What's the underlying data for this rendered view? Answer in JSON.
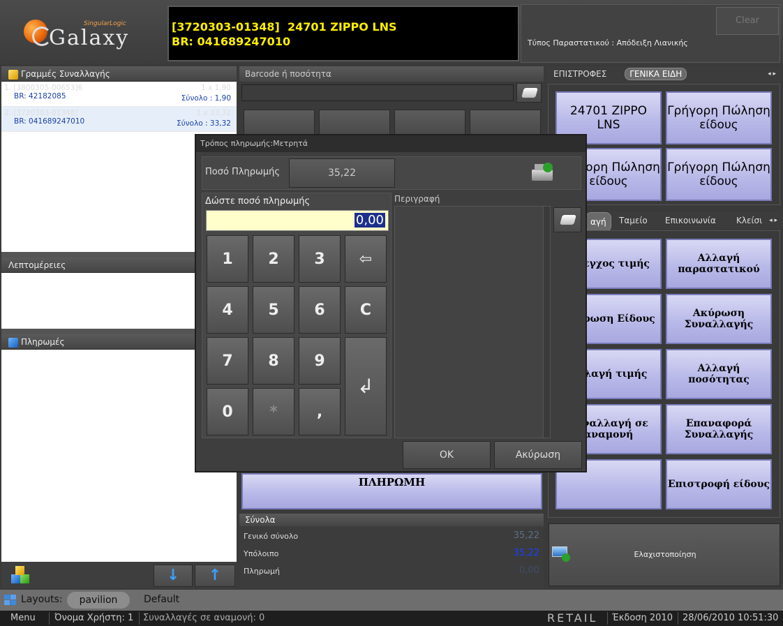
{
  "header": {
    "logo_brand": "SingularLogic",
    "logo_word": "Galaxy",
    "display_line1": "[3720303-01348]  24701 ZIPPO LNS",
    "display_line2": "BR: 041689247010",
    "doc_type": "Τύπος Παραστατικού : Απόδειξη Λιανικής",
    "clear_label": "Clear"
  },
  "transactions": {
    "title": "Γραμμές Συναλλαγής",
    "rows": [
      {
        "code": "1. [3800305-00653]6",
        "qty": "1 x 1,90",
        "br": "BR: 42182085",
        "total": "Σύνολο : 1,90"
      },
      {
        "code": "2. [3720303-01348]",
        "qty": "1 x 33,32",
        "br": "BR: 041689247010",
        "total": "Σύνολο : 33,32"
      }
    ]
  },
  "details": {
    "title": "Λεπτομέρειες"
  },
  "payments": {
    "title": "Πληρωμές"
  },
  "barcode": {
    "title": "Barcode ή ποσότητα",
    "value": ""
  },
  "categories": {
    "tabs": [
      "ΕΠΙΣΤΡΟΦΕΣ",
      "ΓΕΝΙΚΑ ΕΙΔΗ"
    ],
    "items": [
      "24701 ZIPPO LNS",
      "Γρήγορη Πώληση είδους",
      "Γρήγορη Πώληση είδους",
      "Γρήγορη Πώληση είδους"
    ]
  },
  "functions": {
    "tabs": [
      "αγή",
      "Ταμείο",
      "Επικοινωνία",
      "Κλείσι"
    ],
    "items": [
      "Έλεγχος τιμής",
      "Αλλαγή παραστατικού",
      "Ακύρωση Είδους",
      "Ακύρωση Συναλλαγής",
      "Αλλαγή τιμής",
      "Αλλαγή ποσότητας",
      "Συναλλαγή σε αναμονή",
      "Επαναφορά Συναλλαγής",
      "",
      "Επιστροφή είδους"
    ],
    "minimize": "Ελαχιστοποίηση"
  },
  "payment_button": "ΠΛΗΡΩΜΗ",
  "totals": {
    "title": "Σύνολα",
    "grand_total_label": "Γενικό σύνολο",
    "grand_total": "35,22",
    "remaining_label": "Υπόλοιπο",
    "remaining": "35,22",
    "payment_label": "Πληρωμή",
    "payment": "0,00"
  },
  "dialog": {
    "title": "Τρόπος πληρωμής:Μετρητά",
    "amount_label": "Ποσό Πληρωμής",
    "amount": "35,22",
    "enter_label": "Δώστε ποσό πληρωμής",
    "entry_value": "0,00",
    "description_label": "Περιγραφή",
    "keys": [
      "1",
      "2",
      "3",
      "⇦",
      "4",
      "5",
      "6",
      "C",
      "7",
      "8",
      "9",
      "↲",
      "0",
      "*",
      ","
    ],
    "ok": "OK",
    "cancel": "Ακύρωση"
  },
  "layouts": {
    "label": "Layouts:",
    "items": [
      "pavilion",
      "Default"
    ]
  },
  "status": {
    "menu": "Menu",
    "user": "Όνομα Χρήστη: 1",
    "waiting": "Συναλλαγές σε αναμονή: 0",
    "product": "RETAIL",
    "version": "Έκδοση 2010",
    "datetime": "28/06/2010 10:51:30"
  },
  "colors": {
    "display_text": "#ffee00",
    "button_face": "#b7b7e8",
    "remaining": "#1a3fff"
  }
}
